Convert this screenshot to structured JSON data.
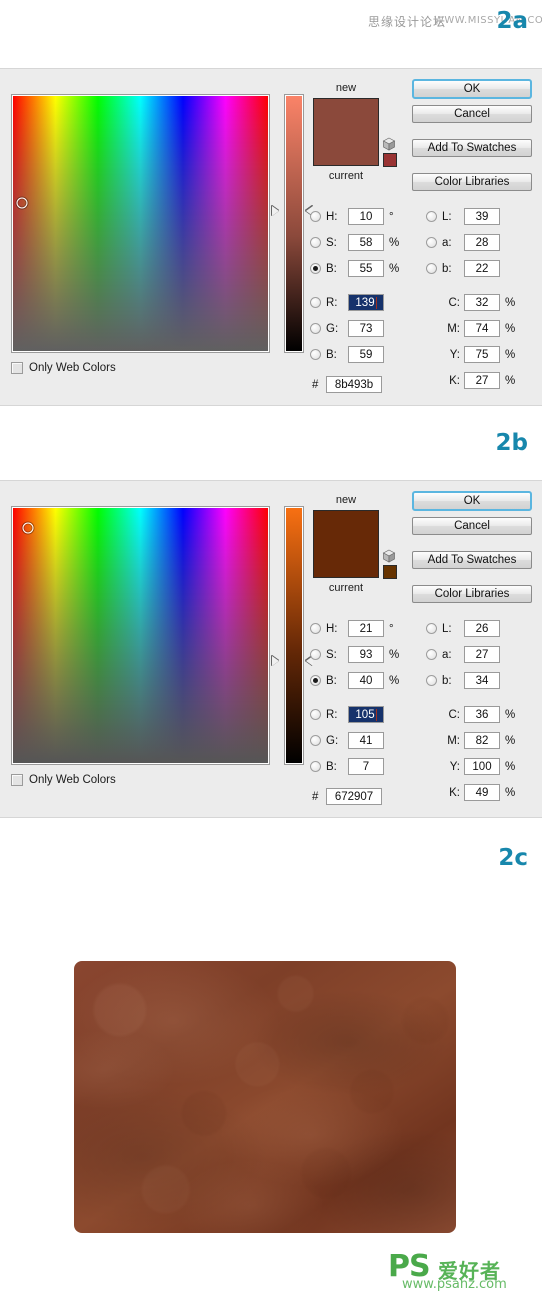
{
  "watermark_top": {
    "chinese": "思缘设计论坛",
    "url": "WWW.MISSYUAN.COM"
  },
  "steps": {
    "a": "2a",
    "b": "2b",
    "c": "2c"
  },
  "accent_color": "#1787ac",
  "dialogs": [
    {
      "id": "picker-a",
      "title_new": "new",
      "title_current": "current",
      "only_web_colors": "Only Web Colors",
      "hash_symbol": "#",
      "buttons": {
        "ok": "OK",
        "cancel": "Cancel",
        "add_to_swatches": "Add To Swatches",
        "color_libraries": "Color Libraries"
      },
      "new_color": "#8b493b",
      "current_color": "#8b493b",
      "websafe_color": "#993333",
      "hue_deg": 10,
      "slider_top_color": "#fa8368",
      "selected_mode": "B",
      "marker_x_pct": 3.5,
      "marker_y_pct": 42,
      "slider_pos_pct": 45,
      "hsb": [
        {
          "name": "H",
          "label": "H:",
          "value": "10",
          "unit": "°",
          "radio": true,
          "on": false
        },
        {
          "name": "S",
          "label": "S:",
          "value": "58",
          "unit": "%",
          "radio": true,
          "on": false
        },
        {
          "name": "B",
          "label": "B:",
          "value": "55",
          "unit": "%",
          "radio": true,
          "on": true
        }
      ],
      "rgb": [
        {
          "name": "R",
          "label": "R:",
          "value": "139",
          "unit": "",
          "radio": true,
          "on": false,
          "selected": true
        },
        {
          "name": "G",
          "label": "G:",
          "value": "73",
          "unit": "",
          "radio": true,
          "on": false,
          "selected": false
        },
        {
          "name": "B2",
          "label": "B:",
          "value": "59",
          "unit": "",
          "radio": true,
          "on": false,
          "selected": false
        }
      ],
      "lab": [
        {
          "name": "L",
          "label": "L:",
          "value": "39",
          "unit": "",
          "radio": true,
          "on": false
        },
        {
          "name": "a",
          "label": "a:",
          "value": "28",
          "unit": "",
          "radio": true,
          "on": false
        },
        {
          "name": "b",
          "label": "b:",
          "value": "22",
          "unit": "",
          "radio": true,
          "on": false
        }
      ],
      "cmyk": [
        {
          "name": "C",
          "label": "C:",
          "value": "32",
          "unit": "%",
          "radio": false
        },
        {
          "name": "M",
          "label": "M:",
          "value": "74",
          "unit": "%",
          "radio": false
        },
        {
          "name": "Y",
          "label": "Y:",
          "value": "75",
          "unit": "%",
          "radio": false
        },
        {
          "name": "K",
          "label": "K:",
          "value": "27",
          "unit": "%",
          "radio": false
        }
      ],
      "hex": "8b493b"
    },
    {
      "id": "picker-b",
      "title_new": "new",
      "title_current": "current",
      "only_web_colors": "Only Web Colors",
      "hash_symbol": "#",
      "buttons": {
        "ok": "OK",
        "cancel": "Cancel",
        "add_to_swatches": "Add To Swatches",
        "color_libraries": "Color Libraries"
      },
      "new_color": "#672907",
      "current_color": "#672907",
      "websafe_color": "#663300",
      "hue_deg": 21,
      "slider_top_color": "#f87012",
      "selected_mode": "B",
      "marker_x_pct": 6,
      "marker_y_pct": 8,
      "slider_pos_pct": 60,
      "hsb": [
        {
          "name": "H",
          "label": "H:",
          "value": "21",
          "unit": "°",
          "radio": true,
          "on": false
        },
        {
          "name": "S",
          "label": "S:",
          "value": "93",
          "unit": "%",
          "radio": true,
          "on": false
        },
        {
          "name": "B",
          "label": "B:",
          "value": "40",
          "unit": "%",
          "radio": true,
          "on": true
        }
      ],
      "rgb": [
        {
          "name": "R",
          "label": "R:",
          "value": "105",
          "unit": "",
          "radio": true,
          "on": false,
          "selected": true
        },
        {
          "name": "G",
          "label": "G:",
          "value": "41",
          "unit": "",
          "radio": true,
          "on": false,
          "selected": false
        },
        {
          "name": "B2",
          "label": "B:",
          "value": "7",
          "unit": "",
          "radio": true,
          "on": false,
          "selected": false
        }
      ],
      "lab": [
        {
          "name": "L",
          "label": "L:",
          "value": "26",
          "unit": "",
          "radio": true,
          "on": false
        },
        {
          "name": "a",
          "label": "a:",
          "value": "27",
          "unit": "",
          "radio": true,
          "on": false
        },
        {
          "name": "b",
          "label": "b:",
          "value": "34",
          "unit": "",
          "radio": true,
          "on": false
        }
      ],
      "cmyk": [
        {
          "name": "C",
          "label": "C:",
          "value": "36",
          "unit": "%",
          "radio": false
        },
        {
          "name": "M",
          "label": "M:",
          "value": "82",
          "unit": "%",
          "radio": false
        },
        {
          "name": "Y",
          "label": "Y:",
          "value": "100",
          "unit": "%",
          "radio": false
        },
        {
          "name": "K",
          "label": "K:",
          "value": "49",
          "unit": "%",
          "radio": false
        }
      ],
      "hex": "672907"
    }
  ],
  "texture": {
    "base_color": "#83442b"
  },
  "footer_logo": {
    "ps": "PS",
    "chinese": "爱好者",
    "url": "www.psahz.com",
    "color": "#4aa94a"
  }
}
